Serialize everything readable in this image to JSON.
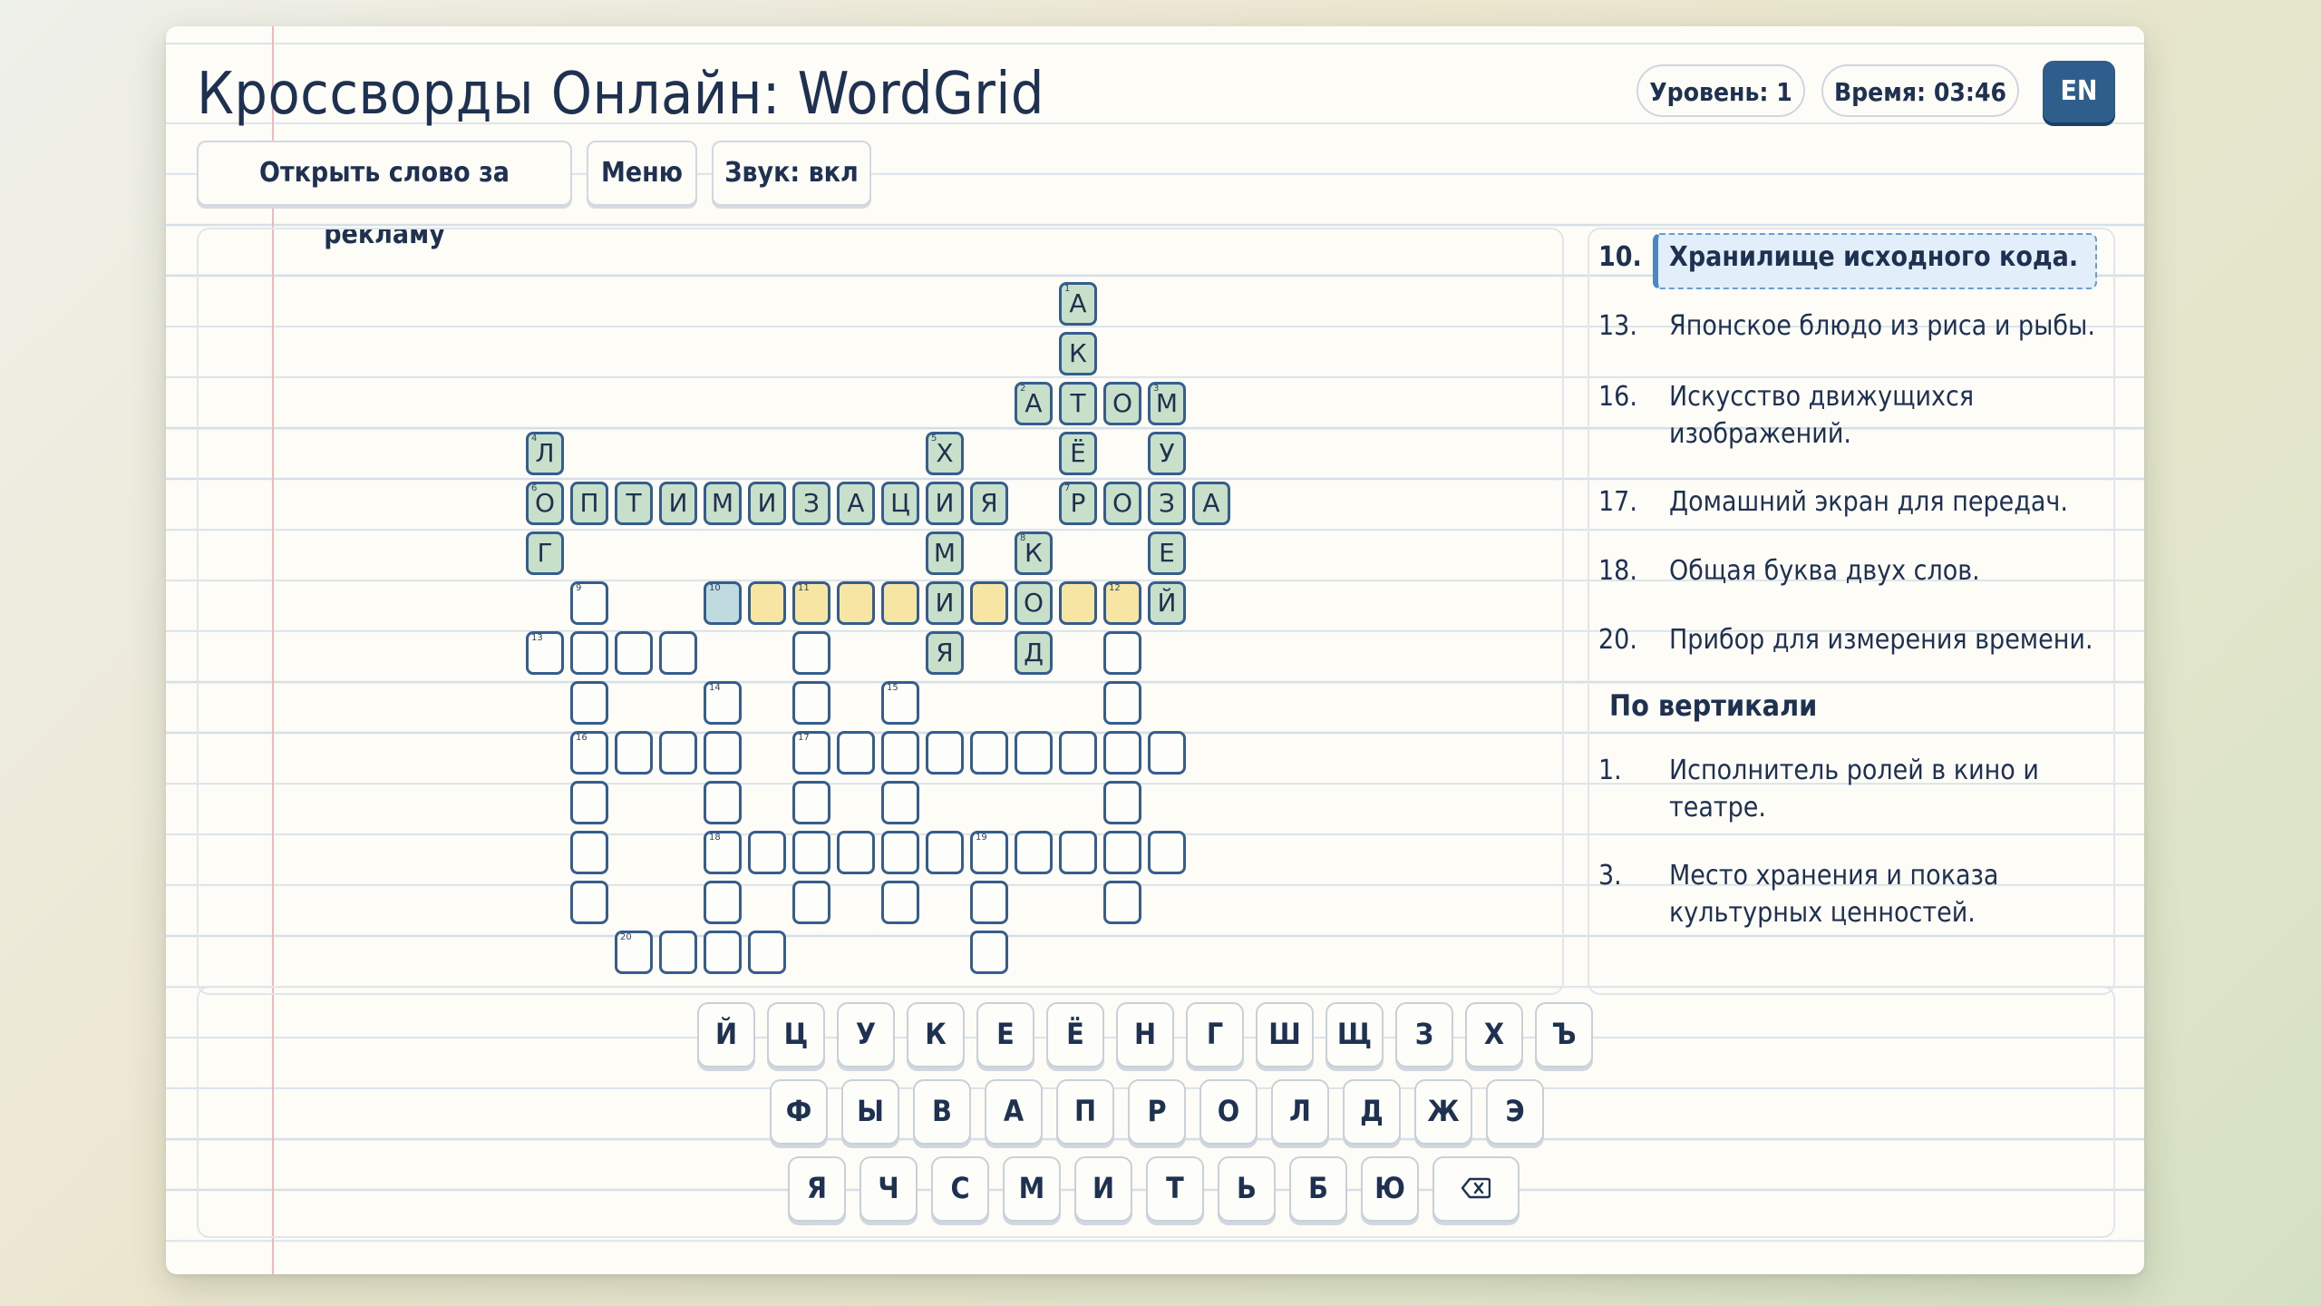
{
  "app": {
    "title": "Кроссворды Онлайн: WordGrid",
    "level": "Уровень: 1",
    "time": "Время: 03:46",
    "lang": "EN"
  },
  "toolbar": {
    "reveal_label": "Открыть слово за рекламу",
    "menu_label": "Меню",
    "sound_label": "Звук: вкл"
  },
  "grid": {
    "cells": [
      {
        "r": 0,
        "c": 12,
        "l": "А",
        "s": "solved",
        "n": "1"
      },
      {
        "r": 1,
        "c": 12,
        "l": "К",
        "s": "solved"
      },
      {
        "r": 2,
        "c": 11,
        "l": "А",
        "s": "solved",
        "n": "2"
      },
      {
        "r": 2,
        "c": 12,
        "l": "Т",
        "s": "solved"
      },
      {
        "r": 2,
        "c": 13,
        "l": "О",
        "s": "solved"
      },
      {
        "r": 2,
        "c": 14,
        "l": "М",
        "s": "solved",
        "n": "3"
      },
      {
        "r": 3,
        "c": 0,
        "l": "Л",
        "s": "solved",
        "n": "4"
      },
      {
        "r": 3,
        "c": 9,
        "l": "Х",
        "s": "solved",
        "n": "5"
      },
      {
        "r": 3,
        "c": 12,
        "l": "Ё",
        "s": "solved"
      },
      {
        "r": 3,
        "c": 14,
        "l": "У",
        "s": "solved"
      },
      {
        "r": 4,
        "c": 0,
        "l": "О",
        "s": "solved",
        "n": "6"
      },
      {
        "r": 4,
        "c": 1,
        "l": "П",
        "s": "solved"
      },
      {
        "r": 4,
        "c": 2,
        "l": "Т",
        "s": "solved"
      },
      {
        "r": 4,
        "c": 3,
        "l": "И",
        "s": "solved"
      },
      {
        "r": 4,
        "c": 4,
        "l": "М",
        "s": "solved"
      },
      {
        "r": 4,
        "c": 5,
        "l": "И",
        "s": "solved"
      },
      {
        "r": 4,
        "c": 6,
        "l": "З",
        "s": "solved"
      },
      {
        "r": 4,
        "c": 7,
        "l": "А",
        "s": "solved"
      },
      {
        "r": 4,
        "c": 8,
        "l": "Ц",
        "s": "solved"
      },
      {
        "r": 4,
        "c": 9,
        "l": "И",
        "s": "solved"
      },
      {
        "r": 4,
        "c": 10,
        "l": "Я",
        "s": "solved"
      },
      {
        "r": 4,
        "c": 12,
        "l": "Р",
        "s": "solved",
        "n": "7"
      },
      {
        "r": 4,
        "c": 13,
        "l": "О",
        "s": "solved"
      },
      {
        "r": 4,
        "c": 14,
        "l": "З",
        "s": "solved"
      },
      {
        "r": 4,
        "c": 15,
        "l": "А",
        "s": "solved"
      },
      {
        "r": 5,
        "c": 0,
        "l": "Г",
        "s": "solved"
      },
      {
        "r": 5,
        "c": 9,
        "l": "М",
        "s": "solved"
      },
      {
        "r": 5,
        "c": 11,
        "l": "К",
        "s": "solved",
        "n": "8"
      },
      {
        "r": 5,
        "c": 14,
        "l": "Е",
        "s": "solved"
      },
      {
        "r": 6,
        "c": 1,
        "l": "",
        "s": "empty",
        "n": "9"
      },
      {
        "r": 6,
        "c": 4,
        "l": "",
        "s": "current",
        "n": "10"
      },
      {
        "r": 6,
        "c": 5,
        "l": "",
        "s": "active"
      },
      {
        "r": 6,
        "c": 6,
        "l": "",
        "s": "active",
        "n": "11"
      },
      {
        "r": 6,
        "c": 7,
        "l": "",
        "s": "active"
      },
      {
        "r": 6,
        "c": 8,
        "l": "",
        "s": "active"
      },
      {
        "r": 6,
        "c": 9,
        "l": "И",
        "s": "solved"
      },
      {
        "r": 6,
        "c": 10,
        "l": "",
        "s": "active"
      },
      {
        "r": 6,
        "c": 11,
        "l": "О",
        "s": "solved"
      },
      {
        "r": 6,
        "c": 12,
        "l": "",
        "s": "active"
      },
      {
        "r": 6,
        "c": 13,
        "l": "",
        "s": "active",
        "n": "12"
      },
      {
        "r": 6,
        "c": 14,
        "l": "Й",
        "s": "solved"
      },
      {
        "r": 7,
        "c": 0,
        "l": "",
        "s": "empty",
        "n": "13"
      },
      {
        "r": 7,
        "c": 1,
        "l": "",
        "s": "empty"
      },
      {
        "r": 7,
        "c": 2,
        "l": "",
        "s": "empty"
      },
      {
        "r": 7,
        "c": 3,
        "l": "",
        "s": "empty"
      },
      {
        "r": 7,
        "c": 6,
        "l": "",
        "s": "empty"
      },
      {
        "r": 7,
        "c": 9,
        "l": "Я",
        "s": "solved"
      },
      {
        "r": 7,
        "c": 11,
        "l": "Д",
        "s": "solved"
      },
      {
        "r": 7,
        "c": 13,
        "l": "",
        "s": "empty"
      },
      {
        "r": 8,
        "c": 1,
        "l": "",
        "s": "empty"
      },
      {
        "r": 8,
        "c": 4,
        "l": "",
        "s": "empty",
        "n": "14"
      },
      {
        "r": 8,
        "c": 6,
        "l": "",
        "s": "empty"
      },
      {
        "r": 8,
        "c": 8,
        "l": "",
        "s": "empty",
        "n": "15"
      },
      {
        "r": 8,
        "c": 13,
        "l": "",
        "s": "empty"
      },
      {
        "r": 9,
        "c": 1,
        "l": "",
        "s": "empty",
        "n": "16"
      },
      {
        "r": 9,
        "c": 2,
        "l": "",
        "s": "empty"
      },
      {
        "r": 9,
        "c": 3,
        "l": "",
        "s": "empty"
      },
      {
        "r": 9,
        "c": 4,
        "l": "",
        "s": "empty"
      },
      {
        "r": 9,
        "c": 6,
        "l": "",
        "s": "empty",
        "n": "17"
      },
      {
        "r": 9,
        "c": 7,
        "l": "",
        "s": "empty"
      },
      {
        "r": 9,
        "c": 8,
        "l": "",
        "s": "empty"
      },
      {
        "r": 9,
        "c": 9,
        "l": "",
        "s": "empty"
      },
      {
        "r": 9,
        "c": 10,
        "l": "",
        "s": "empty"
      },
      {
        "r": 9,
        "c": 11,
        "l": "",
        "s": "empty"
      },
      {
        "r": 9,
        "c": 12,
        "l": "",
        "s": "empty"
      },
      {
        "r": 9,
        "c": 13,
        "l": "",
        "s": "empty"
      },
      {
        "r": 9,
        "c": 14,
        "l": "",
        "s": "empty"
      },
      {
        "r": 10,
        "c": 1,
        "l": "",
        "s": "empty"
      },
      {
        "r": 10,
        "c": 4,
        "l": "",
        "s": "empty"
      },
      {
        "r": 10,
        "c": 6,
        "l": "",
        "s": "empty"
      },
      {
        "r": 10,
        "c": 8,
        "l": "",
        "s": "empty"
      },
      {
        "r": 10,
        "c": 13,
        "l": "",
        "s": "empty"
      },
      {
        "r": 11,
        "c": 1,
        "l": "",
        "s": "empty"
      },
      {
        "r": 11,
        "c": 4,
        "l": "",
        "s": "empty",
        "n": "18"
      },
      {
        "r": 11,
        "c": 5,
        "l": "",
        "s": "empty"
      },
      {
        "r": 11,
        "c": 6,
        "l": "",
        "s": "empty"
      },
      {
        "r": 11,
        "c": 7,
        "l": "",
        "s": "empty"
      },
      {
        "r": 11,
        "c": 8,
        "l": "",
        "s": "empty"
      },
      {
        "r": 11,
        "c": 9,
        "l": "",
        "s": "empty"
      },
      {
        "r": 11,
        "c": 10,
        "l": "",
        "s": "empty",
        "n": "19"
      },
      {
        "r": 11,
        "c": 11,
        "l": "",
        "s": "empty"
      },
      {
        "r": 11,
        "c": 12,
        "l": "",
        "s": "empty"
      },
      {
        "r": 11,
        "c": 13,
        "l": "",
        "s": "empty"
      },
      {
        "r": 11,
        "c": 14,
        "l": "",
        "s": "empty"
      },
      {
        "r": 12,
        "c": 1,
        "l": "",
        "s": "empty"
      },
      {
        "r": 12,
        "c": 4,
        "l": "",
        "s": "empty"
      },
      {
        "r": 12,
        "c": 6,
        "l": "",
        "s": "empty"
      },
      {
        "r": 12,
        "c": 8,
        "l": "",
        "s": "empty"
      },
      {
        "r": 12,
        "c": 10,
        "l": "",
        "s": "empty"
      },
      {
        "r": 12,
        "c": 13,
        "l": "",
        "s": "empty"
      },
      {
        "r": 13,
        "c": 2,
        "l": "",
        "s": "empty",
        "n": "20"
      },
      {
        "r": 13,
        "c": 3,
        "l": "",
        "s": "empty"
      },
      {
        "r": 13,
        "c": 4,
        "l": "",
        "s": "empty"
      },
      {
        "r": 13,
        "c": 5,
        "l": "",
        "s": "empty"
      },
      {
        "r": 13,
        "c": 10,
        "l": "",
        "s": "empty"
      }
    ]
  },
  "clues": {
    "across": [
      {
        "num": "10.",
        "text": "Хранилище исходного кода.",
        "selected": true
      },
      {
        "num": "13.",
        "text": "Японское блюдо из риса и рыбы."
      },
      {
        "num": "16.",
        "text": "Искусство движущихся изображений."
      },
      {
        "num": "17.",
        "text": "Домашний экран для передач."
      },
      {
        "num": "18.",
        "text": "Общая буква двух слов."
      },
      {
        "num": "20.",
        "text": "Прибор для измерения времени."
      }
    ],
    "down_title": "По вертикали",
    "down": [
      {
        "num": "1.",
        "text": "Исполнитель ролей в кино и театре."
      },
      {
        "num": "3.",
        "text": "Место хранения и показа культурных ценностей."
      }
    ]
  },
  "keyboard": {
    "rows": [
      [
        "Й",
        "Ц",
        "У",
        "К",
        "Е",
        "Ё",
        "Н",
        "Г",
        "Ш",
        "Щ",
        "З",
        "Х",
        "Ъ"
      ],
      [
        "Ф",
        "Ы",
        "В",
        "А",
        "П",
        "Р",
        "О",
        "Л",
        "Д",
        "Ж",
        "Э"
      ],
      [
        "Я",
        "Ч",
        "С",
        "М",
        "И",
        "Т",
        "Ь",
        "Б",
        "Ю"
      ]
    ],
    "backspace_icon": "backspace-icon"
  }
}
